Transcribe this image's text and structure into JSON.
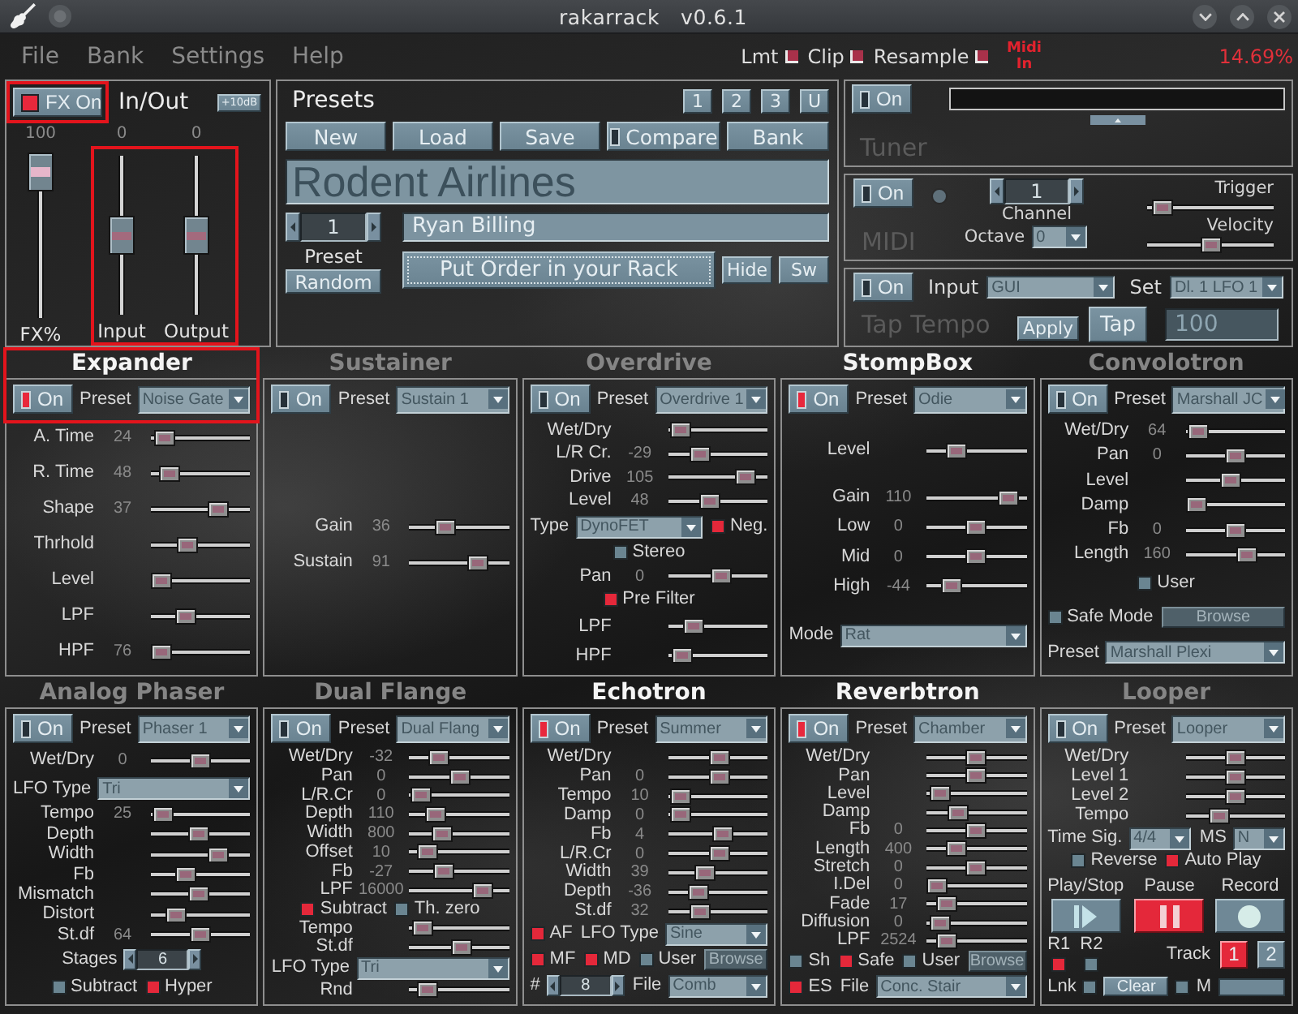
{
  "window": {
    "title": "rakarrack",
    "version": "v0.6.1"
  },
  "menu": [
    "File",
    "Bank",
    "Settings",
    "Help"
  ],
  "status": {
    "indicators": [
      "Lmt",
      "Clip",
      "Resample"
    ],
    "midi_in": "Midi In",
    "cpu_load": "14.69%"
  },
  "in_out": {
    "fx_button": {
      "label": "FX On",
      "on": true,
      "highlighted": true
    },
    "title": "In/Out",
    "boost": "+10dB",
    "gain_highlighted": true,
    "sliders": [
      {
        "label": "FX%",
        "value": "100",
        "level": 1
      },
      {
        "label": "Input",
        "value": "0",
        "level": 0.5
      },
      {
        "label": "Output",
        "value": "0",
        "level": 0.5
      }
    ]
  },
  "presets": {
    "title": "Presets",
    "banks": [
      "1",
      "2",
      "3",
      "U"
    ],
    "buttons": [
      "New",
      "Load",
      "Save"
    ],
    "compare": {
      "label": "Compare",
      "checked": false
    },
    "bank": "Bank",
    "name": "Rodent Airlines",
    "number": "1",
    "number_label": "Preset",
    "random": "Random",
    "author": "Ryan Billing",
    "order": "Put Order in your Rack",
    "hide": "Hide",
    "switch": "Sw"
  },
  "tuner": {
    "on_label": "On",
    "on": false,
    "title": "Tuner"
  },
  "midi": {
    "on_label": "On",
    "on": false,
    "title": "MIDI",
    "channel": "1",
    "channel_label": "Channel",
    "octave_label": "Octave",
    "octave": "0",
    "trigger": {
      "label": "Trigger",
      "level": 0.05
    },
    "velocity": {
      "label": "Velocity",
      "level": 0.5
    }
  },
  "tap_tempo": {
    "on_label": "On",
    "on": false,
    "title": "Tap Tempo",
    "input_label": "Input",
    "input": "GUI",
    "set_label": "Set",
    "set": "Dl. 1 LFO 1",
    "apply": "Apply",
    "tap": "Tap",
    "value": "100"
  },
  "effects": [
    {
      "title": "Expander",
      "on": true,
      "highlighted": true,
      "on_label": "On",
      "preset_label": "Preset",
      "preset": "Noise Gate",
      "sections": [
        [
          {
            "kind": "slider",
            "label": "A. Time",
            "value": "24",
            "level": 0.04
          },
          {
            "kind": "slider",
            "label": "R. Time",
            "value": "48",
            "level": 0.1
          },
          {
            "kind": "slider",
            "label": "Shape",
            "value": "37",
            "level": 0.73
          },
          {
            "kind": "slider",
            "label": "Thrhold",
            "level": 0.33
          },
          {
            "kind": "slider",
            "label": "Level",
            "level": 0
          },
          {
            "kind": "slider",
            "label": "LPF",
            "level": 0.31
          },
          {
            "kind": "slider",
            "label": "HPF",
            "value": "76",
            "level": 0
          }
        ]
      ]
    },
    {
      "title": "Sustainer",
      "on": false,
      "on_label": "On",
      "preset_label": "Preset",
      "preset": "Sustain 1",
      "sections": [
        [
          {
            "kind": "slider",
            "label": "Gain",
            "value": "36",
            "level": 0.32
          },
          {
            "kind": "slider",
            "label": "Sustain",
            "value": "91",
            "level": 0.74
          }
        ]
      ]
    },
    {
      "title": "Overdrive",
      "on": false,
      "on_label": "On",
      "preset_label": "Preset",
      "preset": "Overdrive 1",
      "sections": [
        [
          {
            "kind": "slider",
            "label": "Wet/Dry",
            "level": 0.02
          },
          {
            "kind": "slider",
            "label": "L/R Cr.",
            "value": "-29",
            "level": 0.28
          },
          {
            "kind": "slider",
            "label": "Drive",
            "value": "105",
            "level": 0.85
          },
          {
            "kind": "slider",
            "label": "Level",
            "value": "48",
            "level": 0.4
          }
        ],
        [
          {
            "kind": "row",
            "items": [
              {
                "kind": "select",
                "label": "Type",
                "value": "DynoFET"
              },
              {
                "kind": "check",
                "label": "Neg.",
                "checked": true
              }
            ]
          },
          {
            "kind": "check",
            "label": "Stereo",
            "checked": false
          },
          {
            "kind": "slider",
            "label": "Pan",
            "value": "0",
            "level": 0.55
          },
          {
            "kind": "check",
            "label": "Pre Filter",
            "checked": true
          }
        ],
        [
          {
            "kind": "slider",
            "label": "LPF",
            "level": 0.2
          },
          {
            "kind": "slider",
            "label": "HPF",
            "level": 0.05
          }
        ]
      ]
    },
    {
      "title": "StompBox",
      "on": true,
      "on_label": "On",
      "preset_label": "Preset",
      "preset": "Odie",
      "sections": [
        [
          {
            "kind": "slider",
            "label": "Level",
            "level": 0.25
          }
        ],
        [
          {
            "kind": "slider",
            "label": "Gain",
            "value": "110",
            "level": 0.9
          },
          {
            "kind": "slider",
            "label": "Low",
            "value": "0",
            "level": 0.5
          },
          {
            "kind": "slider",
            "label": "Mid",
            "value": "0",
            "level": 0.5
          },
          {
            "kind": "slider",
            "label": "High",
            "value": "-44",
            "level": 0.18
          }
        ],
        [
          {
            "kind": "select",
            "label": "Mode",
            "value": "Rat"
          }
        ]
      ]
    },
    {
      "title": "Convolotron",
      "on": false,
      "on_label": "On",
      "preset_label": "Preset",
      "preset": "Marshall JC",
      "sections": [
        [
          {
            "kind": "slider",
            "label": "Wet/Dry",
            "value": "64",
            "level": 0.02
          },
          {
            "kind": "slider",
            "label": "Pan",
            "value": "0",
            "level": 0.5
          },
          {
            "kind": "slider",
            "label": "Level",
            "level": 0.44
          },
          {
            "kind": "slider",
            "label": "Damp",
            "level": 0
          },
          {
            "kind": "slider",
            "label": "Fb",
            "value": "0",
            "level": 0.5
          },
          {
            "kind": "slider",
            "label": "Length",
            "value": "160",
            "level": 0.65
          }
        ],
        [
          {
            "kind": "check",
            "label": "User",
            "checked": false
          },
          {
            "kind": "row",
            "items": [
              {
                "kind": "check",
                "label": "Safe Mode",
                "checked": false
              },
              {
                "kind": "button",
                "label": "Browse",
                "disabled": true
              }
            ]
          },
          {
            "kind": "select",
            "label": "Preset",
            "value": "Marshall Plexi"
          }
        ]
      ]
    },
    {
      "title": "Analog Phaser",
      "on": false,
      "on_label": "On",
      "preset_label": "Preset",
      "preset": "Phaser 1",
      "sections": [
        [
          {
            "kind": "slider",
            "label": "Wet/Dry",
            "value": "0",
            "level": 0.5
          },
          {
            "kind": "select",
            "label": "LFO Type",
            "value": "Tri"
          }
        ],
        [
          {
            "kind": "slider",
            "label": "Tempo",
            "value": "25",
            "level": 0.02
          },
          {
            "kind": "slider",
            "label": "Depth",
            "level": 0.47
          },
          {
            "kind": "slider",
            "label": "Width",
            "level": 0.72
          },
          {
            "kind": "slider",
            "label": "Fb",
            "level": 0.3
          },
          {
            "kind": "slider",
            "label": "Mismatch",
            "level": 0.47
          },
          {
            "kind": "slider",
            "label": "Distort",
            "level": 0.19
          },
          {
            "kind": "slider",
            "label": "St.df",
            "value": "64",
            "level": 0.5
          }
        ],
        [
          {
            "kind": "stepper",
            "label": "Stages",
            "value": "6"
          },
          {
            "kind": "row",
            "items": [
              {
                "kind": "check",
                "label": "Subtract",
                "checked": false
              },
              {
                "kind": "check",
                "label": "Hyper",
                "checked": true
              }
            ]
          }
        ]
      ]
    },
    {
      "title": "Dual Flange",
      "on": false,
      "on_label": "On",
      "preset_label": "Preset",
      "preset": "Dual Flang",
      "sections": [
        [
          {
            "kind": "slider",
            "label": "Wet/Dry",
            "value": "-32",
            "level": 0.25
          },
          {
            "kind": "slider",
            "label": "Pan",
            "value": "0",
            "level": 0.5
          },
          {
            "kind": "slider",
            "label": "L/R.Cr",
            "value": "0",
            "level": 0.02
          },
          {
            "kind": "slider",
            "label": "Depth",
            "value": "110",
            "level": 0.2
          },
          {
            "kind": "slider",
            "label": "Width",
            "value": "800",
            "level": 0.28
          },
          {
            "kind": "slider",
            "label": "Offset",
            "value": "10",
            "level": 0.1
          },
          {
            "kind": "slider",
            "label": "Fb",
            "value": "-27",
            "level": 0.3
          },
          {
            "kind": "slider",
            "label": "LPF",
            "value": "16000",
            "level": 0.8
          },
          {
            "kind": "row",
            "items": [
              {
                "kind": "check",
                "label": "Subtract",
                "checked": true
              },
              {
                "kind": "check",
                "label": "Th. zero",
                "checked": false
              }
            ]
          },
          {
            "kind": "slider",
            "label": "Tempo",
            "level": 0.04
          },
          {
            "kind": "slider",
            "label": "St.df",
            "level": 0.52
          },
          {
            "kind": "select",
            "label": "LFO Type",
            "value": "Tri"
          },
          {
            "kind": "slider",
            "label": "Rnd",
            "level": 0.1
          }
        ]
      ]
    },
    {
      "title": "Echotron",
      "on": true,
      "on_label": "On",
      "preset_label": "Preset",
      "preset": "Summer",
      "sections": [
        [
          {
            "kind": "slider",
            "label": "Wet/Dry",
            "level": 0.52
          },
          {
            "kind": "slider",
            "label": "Pan",
            "value": "0",
            "level": 0.52
          },
          {
            "kind": "slider",
            "label": "Tempo",
            "value": "10",
            "level": 0.02
          },
          {
            "kind": "slider",
            "label": "Damp",
            "value": "0",
            "level": 0.02
          },
          {
            "kind": "slider",
            "label": "Fb",
            "value": "4",
            "level": 0.56
          },
          {
            "kind": "slider",
            "label": "L/R.Cr",
            "value": "0",
            "level": 0.52
          },
          {
            "kind": "slider",
            "label": "Width",
            "value": "39",
            "level": 0.33
          },
          {
            "kind": "slider",
            "label": "Depth",
            "value": "-36",
            "level": 0.25
          },
          {
            "kind": "slider",
            "label": "St.df",
            "value": "32",
            "level": 0.27
          }
        ],
        [
          {
            "kind": "row",
            "items": [
              {
                "kind": "check",
                "label": "AF",
                "checked": true
              },
              {
                "kind": "select",
                "label": "LFO Type",
                "value": "Sine"
              }
            ]
          },
          {
            "kind": "row",
            "items": [
              {
                "kind": "check",
                "label": "MF",
                "checked": true
              },
              {
                "kind": "check",
                "label": "MD",
                "checked": true
              },
              {
                "kind": "check",
                "label": "User",
                "checked": false
              },
              {
                "kind": "button",
                "label": "Browse",
                "disabled": true
              }
            ]
          },
          {
            "kind": "row",
            "items": [
              {
                "kind": "stepper",
                "label": "#",
                "value": "8"
              },
              {
                "kind": "select",
                "label": "File",
                "value": "Comb"
              }
            ]
          }
        ]
      ]
    },
    {
      "title": "Reverbtron",
      "on": true,
      "on_label": "On",
      "preset_label": "Preset",
      "preset": "Chamber",
      "sections": [
        [
          {
            "kind": "slider",
            "label": "Wet/Dry",
            "level": 0.5
          },
          {
            "kind": "slider",
            "label": "Pan",
            "level": 0.5
          },
          {
            "kind": "slider",
            "label": "Level",
            "level": 0.04
          },
          {
            "kind": "slider",
            "label": "Damp",
            "level": 0.27
          },
          {
            "kind": "slider",
            "label": "Fb",
            "value": "0",
            "level": 0.5
          },
          {
            "kind": "slider",
            "label": "Length",
            "value": "400",
            "level": 0.25
          },
          {
            "kind": "slider",
            "label": "Stretch",
            "value": "0",
            "level": 0.5
          },
          {
            "kind": "slider",
            "label": "I.Del",
            "value": "0",
            "level": 0
          },
          {
            "kind": "slider",
            "label": "Fade",
            "value": "17",
            "level": 0.12
          },
          {
            "kind": "slider",
            "label": "Diffusion",
            "value": "0",
            "level": 0.03
          },
          {
            "kind": "slider",
            "label": "LPF",
            "value": "2524",
            "level": 0.12
          }
        ],
        [
          {
            "kind": "row",
            "items": [
              {
                "kind": "check",
                "label": "Sh",
                "checked": false
              },
              {
                "kind": "check",
                "label": "Safe",
                "checked": true
              },
              {
                "kind": "check",
                "label": "User",
                "checked": false
              },
              {
                "kind": "button",
                "label": "Browse",
                "disabled": true
              }
            ]
          },
          {
            "kind": "row",
            "items": [
              {
                "kind": "check",
                "label": "ES",
                "checked": true
              },
              {
                "kind": "select",
                "label": "File",
                "value": "Conc. Stair"
              }
            ]
          }
        ]
      ]
    },
    {
      "title": "Looper",
      "on": false,
      "on_label": "On",
      "preset_label": "Preset",
      "preset": "Looper",
      "sections": [
        [
          {
            "kind": "slider",
            "label": "Wet/Dry",
            "level": 0.5
          },
          {
            "kind": "slider",
            "label": "Level 1",
            "level": 0.5
          },
          {
            "kind": "slider",
            "label": "Level 2",
            "level": 0.5
          },
          {
            "kind": "slider",
            "label": "Tempo",
            "level": 0.3
          }
        ],
        [
          {
            "kind": "row",
            "items": [
              {
                "kind": "select",
                "label": "Time Sig.",
                "value": "4/4"
              },
              {
                "kind": "select",
                "label": "MS",
                "value": "N"
              }
            ]
          },
          {
            "kind": "row",
            "items": [
              {
                "kind": "check",
                "label": "Reverse",
                "checked": false
              },
              {
                "kind": "check",
                "label": "Auto Play",
                "checked": true
              }
            ]
          }
        ],
        [
          {
            "kind": "transport",
            "buttons": [
              {
                "kind": "play_stop",
                "label": "Play/Stop",
                "selected": false
              },
              {
                "kind": "pause",
                "label": "Pause",
                "selected": true
              },
              {
                "kind": "record",
                "label": "Record",
                "selected": false
              }
            ]
          },
          {
            "kind": "tracks",
            "records": [
              {
                "label": "R1",
                "checked": true
              },
              {
                "label": "R2",
                "checked": false
              }
            ],
            "track_label": "Track",
            "tracks": [
              {
                "label": "1",
                "selected": true
              },
              {
                "label": "2",
                "selected": false
              }
            ],
            "link": {
              "label": "Lnk",
              "checked": false
            },
            "clear": "Clear",
            "mute": {
              "label": "M",
              "checked": false
            }
          }
        ]
      ]
    }
  ]
}
